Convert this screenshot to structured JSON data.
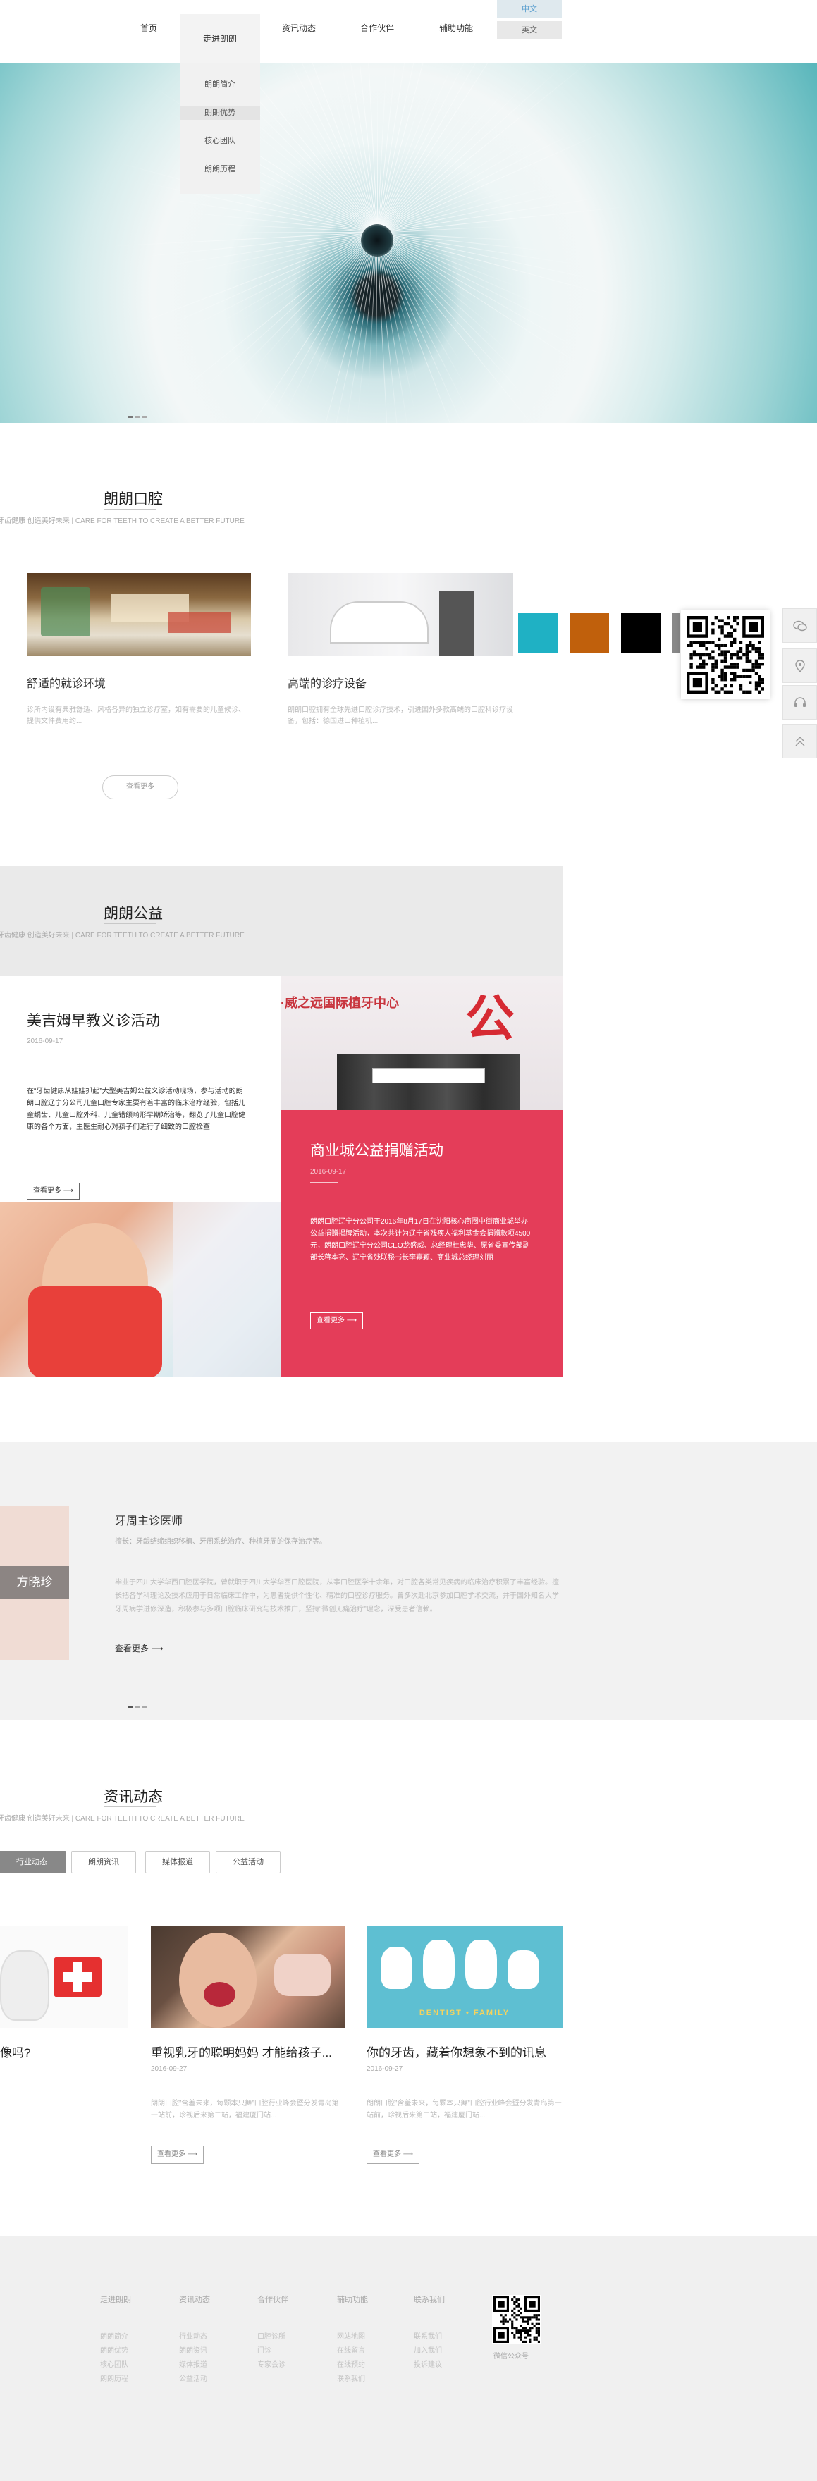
{
  "nav": {
    "items": [
      "首页",
      "走进朗朗",
      "资讯动态",
      "合作伙伴",
      "辅助功能"
    ],
    "dropdown": [
      "朗朗简介",
      "朗朗优势",
      "核心团队",
      "朗朗历程"
    ],
    "lang_cn": "中文",
    "lang_en": "英文"
  },
  "clinic": {
    "title": "朗朗口腔",
    "subtitle": "牙齿健康 创造美好未来 | CARE FOR TEETH TO CREATE A BETTER FUTURE",
    "cards": [
      {
        "title": "舒适的就诊环境",
        "desc": "诊所内设有典雅舒适、风格各异的独立诊疗室，如有需要的儿童候诊、提供文件费用约..."
      },
      {
        "title": "高端的诊疗设备",
        "desc": "朗朗口腔拥有全球先进口腔诊疗技术，引进国外多款高端的口腔科诊疗设备，包括：德国进口种植机..."
      }
    ],
    "more_btn": "查看更多",
    "swatch_colors": [
      "#1fb1c4",
      "#c0600c",
      "#000000",
      "#888888"
    ]
  },
  "charity": {
    "title": "朗朗公益",
    "subtitle": "牙齿健康 创造美好未来 | CARE FOR TEETH TO CREATE A BETTER FUTURE",
    "left": {
      "title": "美吉姆早教义诊活动",
      "date": "2016-09-17",
      "desc": "在“牙齿健康从娃娃抓起”大型美吉姆公益义诊活动现场，参与活动的朗朗口腔辽宁分公司儿童口腔专家主要有着丰富的临床治疗经验，包括儿童龋齿、儿童口腔外科、儿童错颌畸形早期矫治等，翻览了儿童口腔健康的各个方面，主医生耐心对孩子们进行了细致的口腔检查",
      "btn": "查看更多"
    },
    "right": {
      "title": "商业城公益捐赠活动",
      "date": "2016-09-17",
      "desc": "朗朗口腔辽宁分公司于2016年8月17日在沈阳核心商圈中街商业城举办公益捐赠揭牌活动，本次共计为辽宁省残疾人福利基金会捐赠款项4500元，朗朗口腔辽宁分公司CEO龙盛威、总经理杜忠华、原省委宣传部副部长蒋本亮、辽宁省残联秘书长李嘉颖、商业城总经理刘丽",
      "btn": "查看更多",
      "banner_text": "·威之远国际植牙中心",
      "banner_big": "公益"
    }
  },
  "doctor": {
    "name_tag": "方晓珍",
    "title": "牙周主诊医师",
    "specialty": "擅长：牙龈结缔组织移植、牙周系统治疗、种植牙周的保存治疗等。",
    "desc": "毕业于四川大学华西口腔医学院，曾就职于四川大学华西口腔医院，从事口腔医学十余年，对口腔各类常见疾病的临床治疗积累了丰富经验。擅长把各学科理论及技术应用于日常临床工作中，为患者提供个性化、精准的口腔诊疗服务。曾多次赴北京参加口腔学术交流，并于国外知名大学牙周病学进修深造，积极参与多项口腔临床研究与技术推广，坚持“微创无痛治疗”理念，深受患者信赖。",
    "more": "查看更多"
  },
  "news": {
    "title": "资讯动态",
    "subtitle": "牙齿健康 创造美好未来 | CARE FOR TEETH TO CREATE A BETTER FUTURE",
    "tabs": [
      "行业动态",
      "朗朗资讯",
      "媒体报道",
      "公益活动"
    ],
    "items": [
      {
        "title": "像吗?",
        "date": "",
        "desc": "",
        "btn": ""
      },
      {
        "title": "重视乳牙的聪明妈妈 才能给孩子...",
        "date": "2016-09-27",
        "desc": "朗朗口腔”含羞未来，每颗本只舞”口腔行业峰会暨分发青岛第一站前，珍视后来第二站，福建厦门站...",
        "btn": "查看更多"
      },
      {
        "title": "你的牙齿，藏着你想象不到的讯息",
        "date": "2016-09-27",
        "desc": "朗朗口腔”含羞未来，每颗本只舞”口腔行业峰会暨分发青岛第一站前，珍视后来第二站，福建厦门站...",
        "btn": "查看更多"
      }
    ],
    "family_caption": "DENTIST • FAMILY"
  },
  "footer": {
    "columns": [
      {
        "head": "走进朗朗",
        "links": [
          "朗朗简介",
          "朗朗优势",
          "核心团队",
          "朗朗历程"
        ]
      },
      {
        "head": "资讯动态",
        "links": [
          "行业动态",
          "朗朗资讯",
          "媒体报道",
          "公益活动"
        ]
      },
      {
        "head": "合作伙伴",
        "links": [
          "口腔诊所",
          "门诊",
          "专家会诊"
        ]
      },
      {
        "head": "辅助功能",
        "links": [
          "网站地图",
          "在线留言",
          "在线预约",
          "联系我们"
        ]
      },
      {
        "head": "联系我们",
        "links": [
          "联系我们",
          "加入我们",
          "投诉建议"
        ]
      }
    ],
    "qr_caption": "微信公众号"
  },
  "slider_dots": 3
}
